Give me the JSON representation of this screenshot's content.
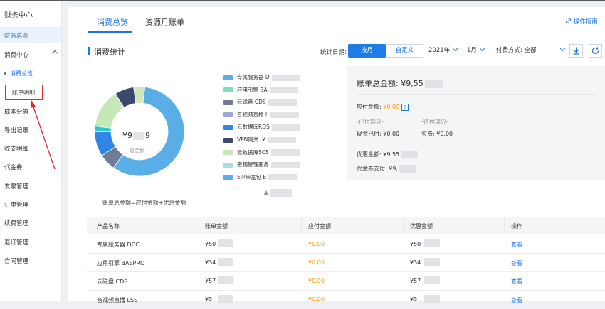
{
  "sidebar": {
    "title": "财务中心",
    "overview": "财务总览",
    "consume_center": "消费中心",
    "sub_items": [
      {
        "label": "消费总览",
        "current": true
      },
      {
        "label": "账单明细",
        "current": false
      }
    ],
    "items": [
      "成本分摊",
      "导出记录",
      "收支明细",
      "代金券",
      "发票管理",
      "订单管理",
      "续费管理",
      "退订管理",
      "合同管理"
    ]
  },
  "tabs": [
    {
      "label": "消费总览",
      "active": true
    },
    {
      "label": "资源月账单",
      "active": false
    }
  ],
  "guide_label": "操作指南",
  "section_title": "消费统计",
  "filters": {
    "label": "统计日期:",
    "by_month": "按月",
    "custom": "自定义",
    "year": "2021年",
    "month": "1月",
    "payment_label": "付费方式:",
    "payment_value": "全部"
  },
  "donut": {
    "center_amount": "¥9",
    "center_amount_tail": "9",
    "center_label": "总金额",
    "formula": "账单总金额=应付金额+优惠金额",
    "colors": [
      "#5aaee8",
      "#6f7c94",
      "#2f86e6",
      "#2ec7c9",
      "#c6e7b7",
      "#3b4a6b",
      "#d2e8b8",
      "#a0a9d8"
    ],
    "segments": [
      0.58,
      0.06,
      0.09,
      0.02,
      0.14,
      0.07,
      0.04
    ]
  },
  "legend": [
    {
      "label": "专属服务器 D",
      "color": "#5aaee8"
    },
    {
      "label": "应用引擎 BA",
      "color": "#7fdcc7"
    },
    {
      "label": "云磁盘 CDS",
      "color": "#6f7c94"
    },
    {
      "label": "音视频直播 L",
      "color": "#9aa8d6"
    },
    {
      "label": "云数据库RDS",
      "color": "#2f86e6"
    },
    {
      "label": "VPN网关: ¥",
      "color": "#3b4a6b"
    },
    {
      "label": "云数据库SCS",
      "color": "#c6e7b7"
    },
    {
      "label": "密钥管理服务",
      "color": "#a7dbe6"
    },
    {
      "label": "EIP带宽包 E",
      "color": "#5aaee8"
    }
  ],
  "summary": {
    "total_label": "账单总金额: ¥9,55",
    "payable_label": "应付金额:",
    "payable_value": "¥0.00",
    "paid_part": "-已付部分-",
    "pending_part": "-待付部分-",
    "cash_paid": "现金已付: ¥0.00",
    "owed": "欠费: ¥0.00",
    "discount": "优惠金额: ¥9,55",
    "voucher": "代金券支付: ¥9,"
  },
  "table": {
    "headers": [
      "产品名称",
      "账单金额",
      "应付金额",
      "优惠金额",
      "操作"
    ],
    "rows": [
      {
        "name": "专属服务器 DCC",
        "bill": "¥50",
        "payable": "¥0.00",
        "discount": "¥50",
        "action": "查看"
      },
      {
        "name": "应用引擎 BAEPRO",
        "bill": "¥34",
        "payable": "¥0.00",
        "discount": "¥34",
        "action": "查看"
      },
      {
        "name": "云磁盘 CDS",
        "bill": "¥57",
        "payable": "¥0.00",
        "discount": "¥57",
        "action": "查看"
      },
      {
        "name": "音视频直播 LSS",
        "bill": "¥3",
        "payable": "¥0.00",
        "discount": "¥3",
        "action": "查看"
      }
    ]
  }
}
